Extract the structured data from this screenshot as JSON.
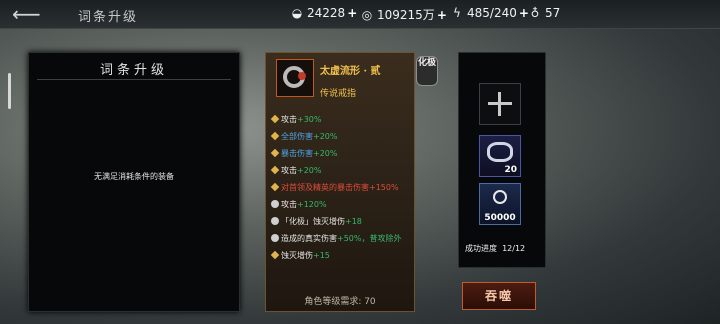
{
  "header": {
    "title": "词条升级",
    "resources": [
      {
        "icon": "ingot-icon",
        "value": "24228"
      },
      {
        "icon": "coin-icon",
        "value": "109215万"
      },
      {
        "icon": "lightning-icon",
        "value": "485/240"
      },
      {
        "icon": "gourd-icon",
        "value": "57"
      }
    ]
  },
  "left_panel": {
    "title": "词条升级",
    "empty_message": "无满足消耗条件的装备"
  },
  "item_card": {
    "name": "太虚流形 · 贰",
    "subtitle": "传说戒指",
    "badge": "化极",
    "stats": [
      {
        "prefix": "攻击",
        "value": "+30%",
        "type": "normal"
      },
      {
        "prefix": "全部伤害",
        "value": "+20%",
        "type": "blue"
      },
      {
        "prefix": "暴击伤害",
        "value": "+20%",
        "type": "blue"
      },
      {
        "prefix": "攻击",
        "value": "+20%",
        "type": "normal"
      },
      {
        "prefix": "对首领及精英的暴击伤害",
        "value": "+150%",
        "type": "red"
      },
      {
        "prefix": "攻击",
        "value": "+120%",
        "type": "rune"
      },
      {
        "prefix": "「化极」蚀灭增伤",
        "value": "+18",
        "type": "rune"
      },
      {
        "prefix": "造成的真实伤害",
        "value": "+50%，普攻除外",
        "type": "rune"
      },
      {
        "prefix": "蚀灭增伤",
        "value": "+15",
        "type": "normal"
      }
    ],
    "level_req": "角色等级需求: 70"
  },
  "right_panel": {
    "slot2_qty": "20",
    "slot3_qty": "50000",
    "progress_label": "成功进度",
    "progress_value": "12/12"
  },
  "action": {
    "swallow_label": "吞噬"
  }
}
